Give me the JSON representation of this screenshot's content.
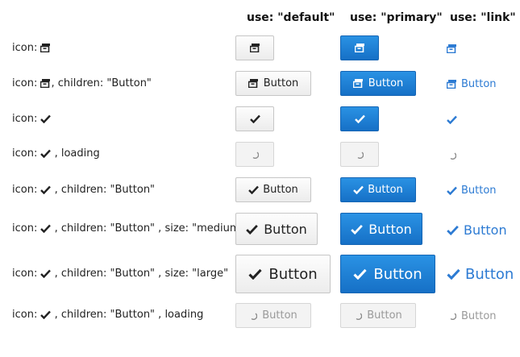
{
  "headers": {
    "default": "use: \"default\"",
    "primary": "use: \"primary\"",
    "link": "use: \"link\""
  },
  "rows": [
    {
      "prefix": "icon: ",
      "icon": "archive-box-icon",
      "suffix": ""
    },
    {
      "prefix": "icon: ",
      "icon": "archive-box-icon",
      "suffix": ", children: \"Button\""
    },
    {
      "prefix": "icon: ",
      "icon": "checkmark-icon",
      "suffix": ""
    },
    {
      "prefix": "icon: ",
      "icon": "checkmark-icon",
      "suffix": " , loading"
    },
    {
      "prefix": "icon: ",
      "icon": "checkmark-icon",
      "suffix": " , children: \"Button\""
    },
    {
      "prefix": "icon: ",
      "icon": "checkmark-icon",
      "suffix": " , children: \"Button\" , size: \"medium\""
    },
    {
      "prefix": "icon: ",
      "icon": "checkmark-icon",
      "suffix": " , children: \"Button\" , size: \"large\""
    },
    {
      "prefix": "icon: ",
      "icon": "checkmark-icon",
      "suffix": " , children: \"Button\" , loading"
    }
  ],
  "button_label": "Button",
  "colors": {
    "primary": "#1c7cd5",
    "link": "#2d7bd3",
    "default_border": "#c6c6c6",
    "loading_text": "#9a9a9a"
  }
}
